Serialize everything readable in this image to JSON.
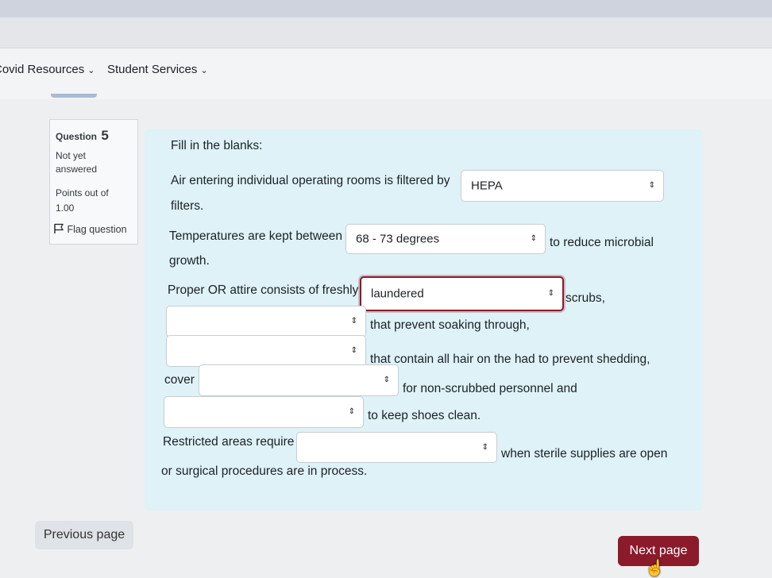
{
  "nav": {
    "covid": "Covid Resources",
    "student": "Student Services",
    "chevron": "⌄"
  },
  "question_info": {
    "label": "Question",
    "number": "5",
    "state": "Not yet answered",
    "grade": "Points out of 1.00",
    "flag": "Flag question"
  },
  "question": {
    "intro": "Fill in the blanks:",
    "s1_before": "Air entering individual operating rooms is filtered by",
    "s1_select": "HEPA",
    "s1_after": "filters.",
    "s2_before": "Temperatures are kept between",
    "s2_select": "68 - 73 degrees",
    "s2_after": "to reduce microbial",
    "s2_cont": "growth.",
    "s3_before": "Proper OR attire consists of freshly",
    "s3_select": "laundered",
    "s3_after": "scrubs,",
    "s4_select": "",
    "s4_after": "that prevent soaking through,",
    "s5_select": "",
    "s5_after": "that contain all hair on the had to prevent shedding,",
    "s6_before": "cover",
    "s6_select": "",
    "s6_after": "for non-scrubbed personnel and",
    "s7_select": "",
    "s7_after": "to keep shoes clean.",
    "s8_before": "Restricted areas require",
    "s8_select": "",
    "s8_after": "when sterile supplies are open",
    "s8_cont": "or surgical procedures are in process.",
    "arrow_glyph": "⇕"
  },
  "buttons": {
    "previous": "Previous page",
    "next": "Next page"
  },
  "colors": {
    "accent": "#8b1a2b",
    "formulation_bg": "#def2f8"
  },
  "icons": {
    "flag": "flag-icon",
    "select_arrow": "select-arrows-icon",
    "cursor": "hand-pointer-icon"
  }
}
